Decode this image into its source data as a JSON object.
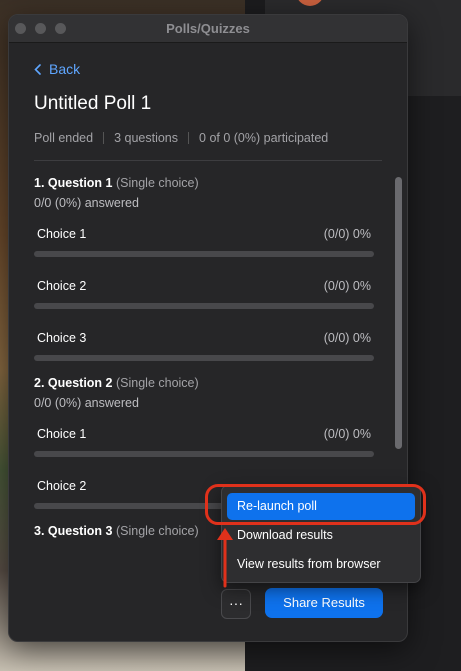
{
  "window": {
    "title": "Polls/Quizzes"
  },
  "nav": {
    "back_label": "Back"
  },
  "poll": {
    "title": "Untitled Poll 1",
    "status": "Poll ended",
    "question_count": "3 questions",
    "participation": "0 of 0 (0%) participated"
  },
  "questions": [
    {
      "heading": "1. Question 1",
      "type": "(Single choice)",
      "answered": "0/0 (0%) answered",
      "choices": [
        {
          "label": "Choice 1",
          "result": "(0/0) 0%",
          "fraction": 0
        },
        {
          "label": "Choice 2",
          "result": "(0/0) 0%",
          "fraction": 0
        },
        {
          "label": "Choice 3",
          "result": "(0/0) 0%",
          "fraction": 0
        }
      ]
    },
    {
      "heading": "2. Question 2",
      "type": "(Single choice)",
      "answered": "0/0 (0%) answered",
      "choices": [
        {
          "label": "Choice 1",
          "result": "(0/0) 0%",
          "fraction": 0
        },
        {
          "label": "Choice 2",
          "result": "",
          "fraction": 0
        }
      ]
    },
    {
      "heading": "3. Question 3",
      "type": "(Single choice)"
    }
  ],
  "footer": {
    "more_label": "···",
    "share_label": "Share Results"
  },
  "menu": {
    "items": [
      "Re-launch poll",
      "Download results",
      "View results from browser"
    ],
    "selected_index": 0
  },
  "colors": {
    "accent": "#0e72ed",
    "annotation": "#e0311b"
  }
}
